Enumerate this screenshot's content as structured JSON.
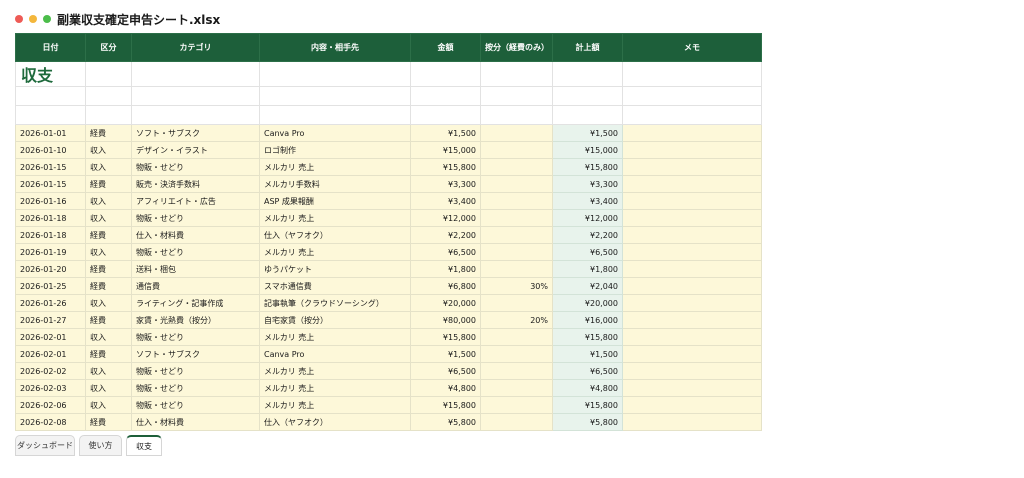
{
  "window": {
    "title": "副業収支確定申告シート.xlsx"
  },
  "sheet": {
    "title": "収支",
    "headers": [
      "日付",
      "区分",
      "カテゴリ",
      "内容・相手先",
      "金額",
      "按分（経費のみ）",
      "計上額",
      "メモ"
    ],
    "rows": [
      [
        "2026-01-01",
        "経費",
        "ソフト・サブスク",
        "Canva Pro",
        "¥1,500",
        "",
        "¥1,500",
        ""
      ],
      [
        "2026-01-10",
        "収入",
        "デザイン・イラスト",
        "ロゴ制作",
        "¥15,000",
        "",
        "¥15,000",
        ""
      ],
      [
        "2026-01-15",
        "収入",
        "物販・せどり",
        "メルカリ 売上",
        "¥15,800",
        "",
        "¥15,800",
        ""
      ],
      [
        "2026-01-15",
        "経費",
        "販売・決済手数料",
        "メルカリ手数料",
        "¥3,300",
        "",
        "¥3,300",
        ""
      ],
      [
        "2026-01-16",
        "収入",
        "アフィリエイト・広告",
        "ASP 成果報酬",
        "¥3,400",
        "",
        "¥3,400",
        ""
      ],
      [
        "2026-01-18",
        "収入",
        "物販・せどり",
        "メルカリ 売上",
        "¥12,000",
        "",
        "¥12,000",
        ""
      ],
      [
        "2026-01-18",
        "経費",
        "仕入・材料費",
        "仕入（ヤフオク）",
        "¥2,200",
        "",
        "¥2,200",
        ""
      ],
      [
        "2026-01-19",
        "収入",
        "物販・せどり",
        "メルカリ 売上",
        "¥6,500",
        "",
        "¥6,500",
        ""
      ],
      [
        "2026-01-20",
        "経費",
        "送料・梱包",
        "ゆうパケット",
        "¥1,800",
        "",
        "¥1,800",
        ""
      ],
      [
        "2026-01-25",
        "経費",
        "通信費",
        "スマホ通信費",
        "¥6,800",
        "30%",
        "¥2,040",
        ""
      ],
      [
        "2026-01-26",
        "収入",
        "ライティング・記事作成",
        "記事執筆（クラウドソーシング）",
        "¥20,000",
        "",
        "¥20,000",
        ""
      ],
      [
        "2026-01-27",
        "経費",
        "家賃・光熱費（按分）",
        "自宅家賃（按分）",
        "¥80,000",
        "20%",
        "¥16,000",
        ""
      ],
      [
        "2026-02-01",
        "収入",
        "物販・せどり",
        "メルカリ 売上",
        "¥15,800",
        "",
        "¥15,800",
        ""
      ],
      [
        "2026-02-01",
        "経費",
        "ソフト・サブスク",
        "Canva Pro",
        "¥1,500",
        "",
        "¥1,500",
        ""
      ],
      [
        "2026-02-02",
        "収入",
        "物販・せどり",
        "メルカリ 売上",
        "¥6,500",
        "",
        "¥6,500",
        ""
      ],
      [
        "2026-02-03",
        "収入",
        "物販・せどり",
        "メルカリ 売上",
        "¥4,800",
        "",
        "¥4,800",
        ""
      ],
      [
        "2026-02-06",
        "収入",
        "物販・せどり",
        "メルカリ 売上",
        "¥15,800",
        "",
        "¥15,800",
        ""
      ],
      [
        "2026-02-08",
        "経費",
        "仕入・材料費",
        "仕入（ヤフオク）",
        "¥5,800",
        "",
        "¥5,800",
        ""
      ]
    ]
  },
  "tabs": [
    {
      "label": "ダッシュボード",
      "active": false
    },
    {
      "label": "使い方",
      "active": false
    },
    {
      "label": "収支",
      "active": true
    }
  ],
  "colors": {
    "header_bg": "#1d5f3a",
    "title_text": "#1e6a3c",
    "row_bg": "#fdf8d9",
    "calc_bg": "#e8f3ec"
  }
}
